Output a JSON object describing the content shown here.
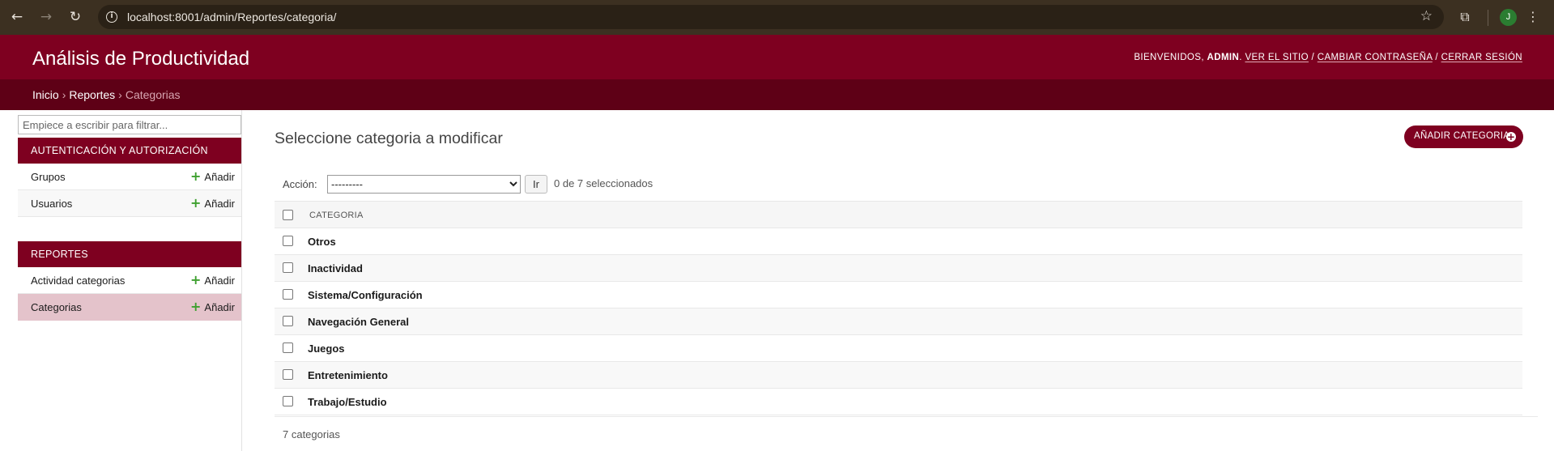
{
  "browser": {
    "url": "localhost:8001/admin/Reportes/categoria/",
    "profile_initial": "J"
  },
  "header": {
    "brand": "Análisis de Productividad",
    "welcome": "BIENVENIDOS,",
    "username": "ADMIN",
    "links": [
      "VER EL SITIO",
      "CAMBIAR CONTRASEÑA",
      "CERRAR SESIÓN"
    ]
  },
  "breadcrumbs": [
    "Inicio",
    "Reportes",
    "Categorias"
  ],
  "sidebar": {
    "filter_placeholder": "Empiece a escribir para filtrar...",
    "modules": [
      {
        "caption": "AUTENTICACIÓN Y AUTORIZACIÓN",
        "models": [
          {
            "name": "Grupos",
            "add": "Añadir"
          },
          {
            "name": "Usuarios",
            "add": "Añadir"
          }
        ]
      },
      {
        "caption": "REPORTES",
        "models": [
          {
            "name": "Actividad categorias",
            "add": "Añadir"
          },
          {
            "name": "Categorias",
            "add": "Añadir",
            "selected": true
          }
        ]
      }
    ]
  },
  "main": {
    "title": "Seleccione categoria a modificar",
    "add_button": "AÑADIR CATEGORIA",
    "actions": {
      "label": "Acción:",
      "selected_option": "---------",
      "go_label": "Ir",
      "counter": "0 de 7 seleccionados"
    },
    "table": {
      "column": "CATEGORIA",
      "rows": [
        "Otros",
        "Inactividad",
        "Sistema/Configuración",
        "Navegación General",
        "Juegos",
        "Entretenimiento",
        "Trabajo/Estudio"
      ]
    },
    "paginator": "7 categorias"
  },
  "colors": {
    "header_bg": "#7e0020",
    "breadcrumb_bg": "#5e0016",
    "selected_row": "#e4c3cb",
    "add_plus": "#3ea02f"
  },
  "icons": {
    "back": "arrow-left-icon",
    "forward": "arrow-right-icon",
    "reload": "reload-icon",
    "site_info": "info-icon",
    "bookmark": "star-icon",
    "extensions": "puzzle-icon",
    "menu": "kebab-menu-icon"
  }
}
